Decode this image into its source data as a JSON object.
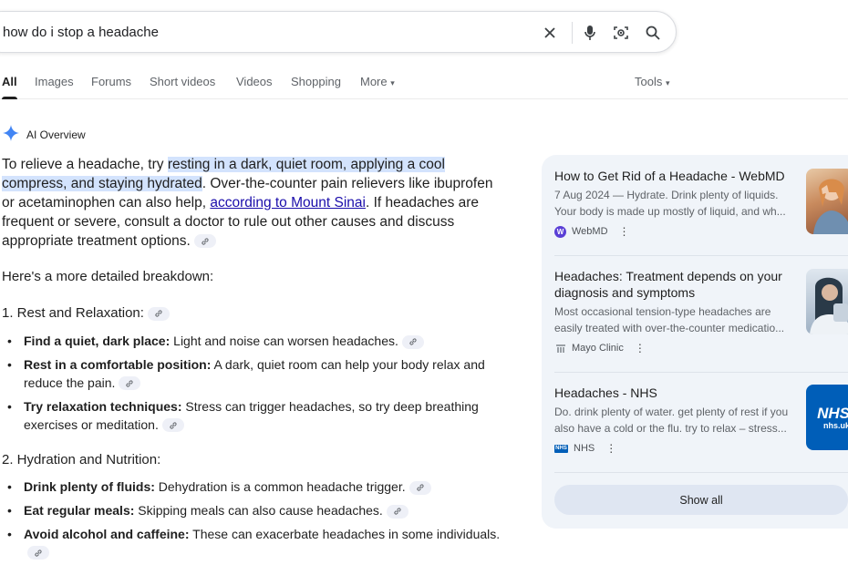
{
  "search": {
    "query": "how do i stop a headache"
  },
  "tabs": [
    "All",
    "Images",
    "Forums",
    "Short videos",
    "Videos",
    "Shopping",
    "More",
    "Tools"
  ],
  "ai_overview": {
    "header": "AI Overview",
    "intro_pre": "To relieve a headache, try ",
    "intro_highlight": "resting in a dark, quiet room, applying a cool compress, and staying hydrated",
    "intro_mid": ". Over-the-counter pain relievers like ibuprofen or acetaminophen can also help, ",
    "intro_link": "according to Mount Sinai",
    "intro_post": ". If headaches are frequent or severe, consult a doctor to rule out other causes and discuss appropriate treatment options.",
    "breakdown": "Here's a more detailed breakdown:",
    "sections": [
      {
        "heading": "1. Rest and Relaxation:",
        "items": [
          {
            "bold": "Find a quiet, dark place:",
            "text": " Light and noise can worsen headaches."
          },
          {
            "bold": "Rest in a comfortable position:",
            "text": " A dark, quiet room can help your body relax and reduce the pain."
          },
          {
            "bold": "Try relaxation techniques:",
            "text": " Stress can trigger headaches, so try deep breathing exercises or meditation."
          }
        ]
      },
      {
        "heading": "2. Hydration and Nutrition:",
        "items": [
          {
            "bold": "Drink plenty of fluids:",
            "text": " Dehydration is a common headache trigger."
          },
          {
            "bold": "Eat regular meals:",
            "text": " Skipping meals can also cause headaches."
          },
          {
            "bold": "Avoid alcohol and caffeine:",
            "text": " These can exacerbate headaches in some individuals."
          }
        ]
      }
    ]
  },
  "sources": [
    {
      "title": "How to Get Rid of a Headache - WebMD",
      "snippet": "7 Aug 2024 — Hydrate. Drink plenty of liquids. Your body is made up mostly of liquid, and wh...",
      "site": "WebMD",
      "favicon_letter": "W",
      "favicon_color": "#5a3fd6"
    },
    {
      "title": "Headaches: Treatment depends on your diagnosis and symptoms",
      "snippet": "Most occasional tension-type headaches are easily treated with over-the-counter medicatio...",
      "site": "Mayo Clinic",
      "favicon_letter": "",
      "favicon_color": "#9aa0a6"
    },
    {
      "title": "Headaches - NHS",
      "snippet": "Do. drink plenty of water. get plenty of rest if you also have a cold or the flu. try to relax – stress...",
      "site": "NHS",
      "favicon_letter": "NHS",
      "favicon_color": "#005eb8",
      "thumb_logo": "NHS",
      "thumb_sub": "nhs.uk"
    }
  ],
  "show_all": "Show all"
}
